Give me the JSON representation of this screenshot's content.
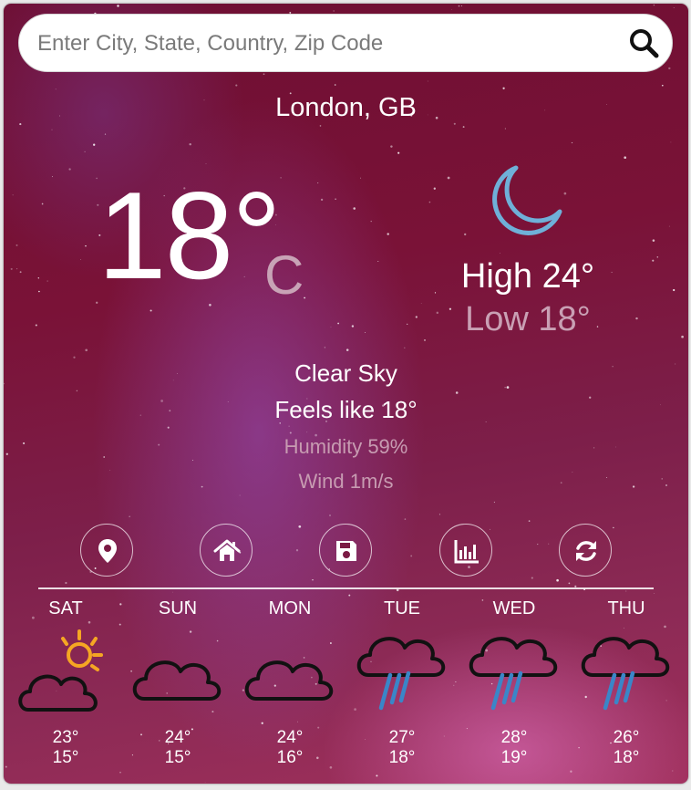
{
  "search": {
    "placeholder": "Enter City, State, Country, Zip Code"
  },
  "location": "London, GB",
  "current": {
    "temp": "18°",
    "unit": "C",
    "condition_icon": "moon-icon",
    "high": "High 24°",
    "low": "Low 18°",
    "description": "Clear Sky",
    "feels_like": "Feels like 18°",
    "humidity": "Humidity 59%",
    "wind": "Wind 1m/s"
  },
  "actions": [
    {
      "icon": "location-pin-icon"
    },
    {
      "icon": "home-icon"
    },
    {
      "icon": "save-icon"
    },
    {
      "icon": "chart-icon"
    },
    {
      "icon": "refresh-icon"
    }
  ],
  "forecast": [
    {
      "day": "SAT",
      "icon": "partly-sunny-icon",
      "high": "23°",
      "low": "15°"
    },
    {
      "day": "SUN",
      "icon": "cloud-icon",
      "high": "24°",
      "low": "15°"
    },
    {
      "day": "MON",
      "icon": "cloud-icon",
      "high": "24°",
      "low": "16°"
    },
    {
      "day": "TUE",
      "icon": "rain-cloud-icon",
      "high": "27°",
      "low": "18°"
    },
    {
      "day": "WED",
      "icon": "rain-cloud-icon",
      "high": "28°",
      "low": "19°"
    },
    {
      "day": "THU",
      "icon": "rain-cloud-icon",
      "high": "26°",
      "low": "18°"
    }
  ],
  "colors": {
    "moon": "#6fb0d8",
    "sun": "#f5a623",
    "rain": "#3a86c8"
  }
}
